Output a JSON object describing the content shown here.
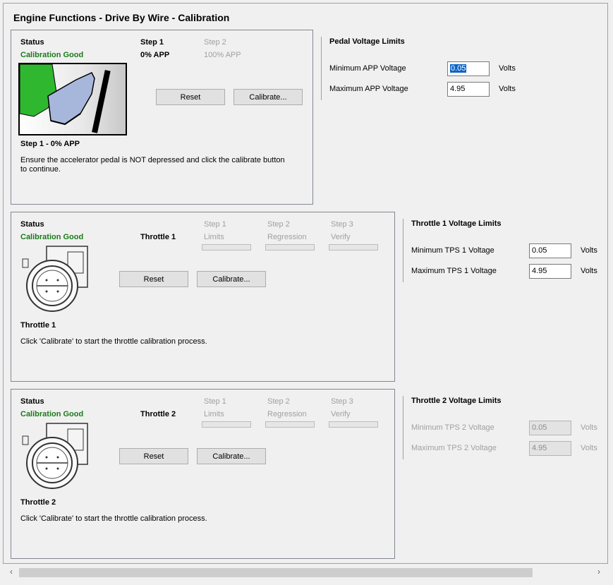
{
  "title": "Engine Functions - Drive By Wire - Calibration",
  "pedal": {
    "status_label": "Status",
    "status_value": "Calibration Good",
    "step1_label": "Step 1",
    "step1_value": "0% APP",
    "step2_label": "Step 2",
    "step2_value": "100% APP",
    "reset_label": "Reset",
    "calibrate_label": "Calibrate...",
    "step_heading": "Step 1 - 0% APP",
    "description": "Ensure the accelerator pedal is NOT depressed and click the calibrate button to continue.",
    "limits": {
      "heading": "Pedal Voltage Limits",
      "min_label": "Minimum APP Voltage",
      "min_value": "0.05",
      "max_label": "Maximum APP Voltage",
      "max_value": "4.95",
      "unit": "Volts"
    }
  },
  "throttle1": {
    "status_label": "Status",
    "status_value": "Calibration Good",
    "name": "Throttle 1",
    "step1_label": "Step 1",
    "step1_value": "Limits",
    "step2_label": "Step 2",
    "step2_value": "Regression",
    "step3_label": "Step 3",
    "step3_value": "Verify",
    "reset_label": "Reset",
    "calibrate_label": "Calibrate...",
    "heading": "Throttle 1",
    "description": "Click 'Calibrate' to start the throttle calibration process.",
    "limits": {
      "heading": "Throttle 1 Voltage Limits",
      "min_label": "Minimum TPS 1 Voltage",
      "min_value": "0.05",
      "max_label": "Maximum TPS 1 Voltage",
      "max_value": "4.95",
      "unit": "Volts"
    }
  },
  "throttle2": {
    "status_label": "Status",
    "status_value": "Calibration Good",
    "name": "Throttle 2",
    "step1_label": "Step 1",
    "step1_value": "Limits",
    "step2_label": "Step 2",
    "step2_value": "Regression",
    "step3_label": "Step 3",
    "step3_value": "Verify",
    "reset_label": "Reset",
    "calibrate_label": "Calibrate...",
    "heading": "Throttle 2",
    "description": "Click 'Calibrate' to start the throttle calibration process.",
    "limits": {
      "heading": "Throttle 2 Voltage Limits",
      "min_label": "Minimum TPS 2 Voltage",
      "min_value": "0.05",
      "max_label": "Maximum TPS 2 Voltage",
      "max_value": "4.95",
      "unit": "Volts"
    }
  },
  "scrollbar": {
    "left_arrow": "‹",
    "right_arrow": "›"
  },
  "colors": {
    "status_good": "#1a7a1a",
    "disabled_text": "#a0a0a0",
    "selection": "#0a64c8"
  }
}
